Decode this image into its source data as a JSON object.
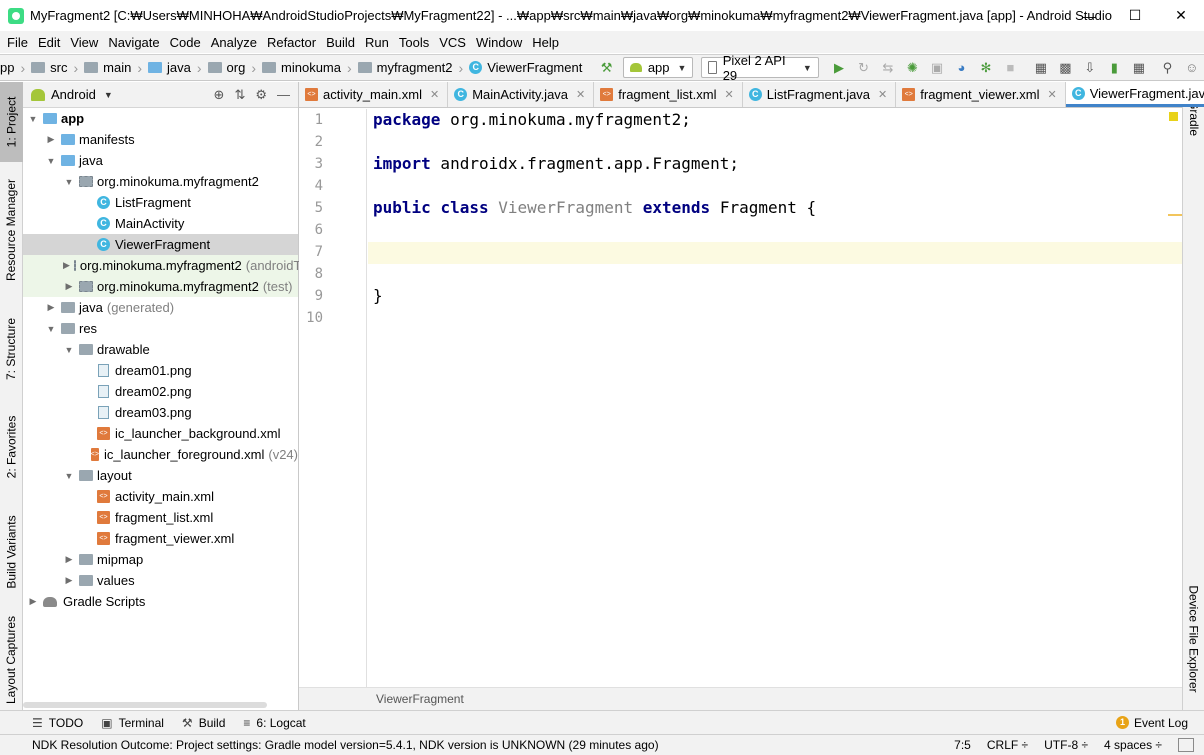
{
  "window": {
    "title": "MyFragment2 [C:₩Users₩MINHOHA₩AndroidStudioProjects₩MyFragment22] - ...₩app₩src₩main₩java₩org₩minokuma₩myfragment2₩ViewerFragment.java [app] - Android Studio",
    "minimize": "—",
    "maximize": "☐",
    "close": "✕"
  },
  "menu": [
    "File",
    "Edit",
    "View",
    "Navigate",
    "Code",
    "Analyze",
    "Refactor",
    "Build",
    "Run",
    "Tools",
    "VCS",
    "Window",
    "Help"
  ],
  "navbar": {
    "crumbs": [
      "pp",
      "src",
      "main",
      "java",
      "org",
      "minokuma",
      "myfragment2",
      "ViewerFragment"
    ],
    "run_config": "app",
    "device": "Pixel 2 API 29"
  },
  "left_strip": {
    "project": "1: Project",
    "resource_manager": "Resource Manager",
    "structure": "7: Structure",
    "favorites": "2: Favorites",
    "build_variants": "Build Variants",
    "layout_captures": "Layout Captures"
  },
  "right_strip": {
    "gradle": "Gradle",
    "device_file_explorer": "Device File Explorer"
  },
  "project_panel": {
    "view_mode": "Android",
    "tree": [
      {
        "label": "app",
        "depth": 0,
        "expanded": true,
        "icon": "app-folder",
        "bold": true
      },
      {
        "label": "manifests",
        "depth": 1,
        "expanded": false,
        "icon": "folder-blue"
      },
      {
        "label": "java",
        "depth": 1,
        "expanded": true,
        "icon": "folder-blue"
      },
      {
        "label": "org.minokuma.myfragment2",
        "depth": 2,
        "expanded": true,
        "icon": "package"
      },
      {
        "label": "ListFragment",
        "depth": 3,
        "icon": "class"
      },
      {
        "label": "MainActivity",
        "depth": 3,
        "icon": "class"
      },
      {
        "label": "ViewerFragment",
        "depth": 3,
        "icon": "class",
        "selected": true
      },
      {
        "label": "org.minokuma.myfragment2",
        "suffix": "(androidTest)",
        "depth": 2,
        "expanded": false,
        "icon": "package",
        "green": true
      },
      {
        "label": "org.minokuma.myfragment2",
        "suffix": "(test)",
        "depth": 2,
        "expanded": false,
        "icon": "package",
        "green": true
      },
      {
        "label": "java",
        "suffix": "(generated)",
        "depth": 1,
        "expanded": false,
        "icon": "folder-gray"
      },
      {
        "label": "res",
        "depth": 1,
        "expanded": true,
        "icon": "folder-gray"
      },
      {
        "label": "drawable",
        "depth": 2,
        "expanded": true,
        "icon": "folder-gray"
      },
      {
        "label": "dream01.png",
        "depth": 3,
        "icon": "image-file"
      },
      {
        "label": "dream02.png",
        "depth": 3,
        "icon": "image-file"
      },
      {
        "label": "dream03.png",
        "depth": 3,
        "icon": "image-file"
      },
      {
        "label": "ic_launcher_background.xml",
        "depth": 3,
        "icon": "xml-file"
      },
      {
        "label": "ic_launcher_foreground.xml",
        "suffix": "(v24)",
        "depth": 3,
        "icon": "xml-file"
      },
      {
        "label": "layout",
        "depth": 2,
        "expanded": true,
        "icon": "folder-gray"
      },
      {
        "label": "activity_main.xml",
        "depth": 3,
        "icon": "xml-file"
      },
      {
        "label": "fragment_list.xml",
        "depth": 3,
        "icon": "xml-file"
      },
      {
        "label": "fragment_viewer.xml",
        "depth": 3,
        "icon": "xml-file"
      },
      {
        "label": "mipmap",
        "depth": 2,
        "expanded": false,
        "icon": "folder-gray"
      },
      {
        "label": "values",
        "depth": 2,
        "expanded": false,
        "icon": "folder-gray"
      },
      {
        "label": "Gradle Scripts",
        "depth": 0,
        "expanded": false,
        "icon": "gradle"
      }
    ]
  },
  "tabs": [
    {
      "label": "activity_main.xml",
      "icon": "xml",
      "active": false
    },
    {
      "label": "MainActivity.java",
      "icon": "class",
      "active": false
    },
    {
      "label": "fragment_list.xml",
      "icon": "xml",
      "active": false
    },
    {
      "label": "ListFragment.java",
      "icon": "class",
      "active": false
    },
    {
      "label": "fragment_viewer.xml",
      "icon": "xml",
      "active": false
    },
    {
      "label": "ViewerFragment.java",
      "icon": "class",
      "active": true
    }
  ],
  "editor": {
    "lines": [
      [
        {
          "t": "package",
          "k": "kw"
        },
        {
          "t": " org.minokuma.myfragment2;"
        }
      ],
      [],
      [
        {
          "t": "import",
          "k": "kw"
        },
        {
          "t": " androidx.fragment.app.Fragment;"
        }
      ],
      [],
      [
        {
          "t": "public",
          "k": "kw"
        },
        {
          "t": " "
        },
        {
          "t": "class",
          "k": "kw"
        },
        {
          "t": " "
        },
        {
          "t": "ViewerFragment",
          "k": "unused"
        },
        {
          "t": " "
        },
        {
          "t": "extends",
          "k": "kw"
        },
        {
          "t": " Fragment {"
        }
      ],
      [],
      [],
      [],
      [
        {
          "t": "}"
        }
      ],
      []
    ],
    "current_line": 7,
    "breadcrumb": "ViewerFragment"
  },
  "bottom_tabs": [
    {
      "label": "TODO",
      "icon": "☰"
    },
    {
      "label": "Terminal",
      "icon": "▣"
    },
    {
      "label": "Build",
      "icon": "⚒"
    },
    {
      "label": "6: Logcat",
      "icon": "≡"
    }
  ],
  "event_log": {
    "count": "1",
    "label": "Event Log"
  },
  "status": {
    "message": "NDK Resolution Outcome: Project settings: Gradle model version=5.4.1, NDK version is UNKNOWN (29 minutes ago)",
    "position": "7:5",
    "line_sep": "CRLF ÷",
    "encoding": "UTF-8 ÷",
    "indent": "4 spaces ÷"
  }
}
